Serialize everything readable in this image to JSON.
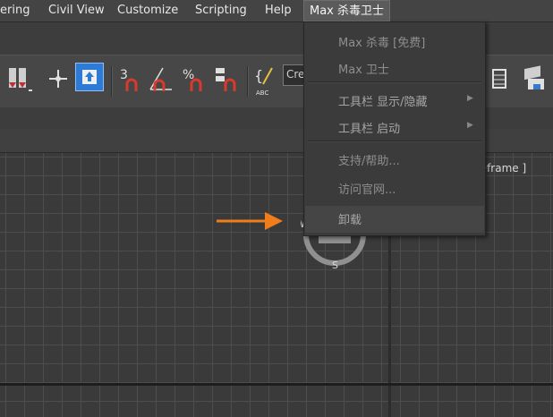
{
  "menubar": {
    "items": [
      "ering",
      "Civil View",
      "Customize",
      "Scripting",
      "Help"
    ],
    "active": "Max 杀毒卫士"
  },
  "toolbar": {
    "field_text": "Cre",
    "icons": [
      "mirror-icon",
      "move-icon",
      "select-link-icon",
      "snap-3d-icon",
      "angle-snap-icon",
      "percent-snap-icon",
      "spinner-snap-icon",
      "edit-named-selection-icon",
      "named-selection-field",
      "layer-icon",
      "scene-explorer-icon"
    ]
  },
  "dropdown": {
    "items": [
      {
        "label": "Max 杀毒 [免费]",
        "submenu": false
      },
      {
        "label": "Max 卫士",
        "submenu": false
      },
      {
        "label": "工具栏 显示/隐藏",
        "submenu": true
      },
      {
        "label": "工具栏 启动",
        "submenu": true
      },
      {
        "label": "支持/帮助...",
        "submenu": false
      },
      {
        "label": "访问官网...",
        "submenu": false
      },
      {
        "label": "卸载",
        "submenu": false
      }
    ]
  },
  "viewport": {
    "label": "reframe ]",
    "compass": {
      "west": "W",
      "south": "S"
    }
  },
  "colors": {
    "menubar_bg": "#444444",
    "dropdown_bg": "#3b3b3b",
    "arrow": "#f07d1a",
    "active_tool": "#2d7bd6",
    "magnet_red": "#d83a2e"
  }
}
